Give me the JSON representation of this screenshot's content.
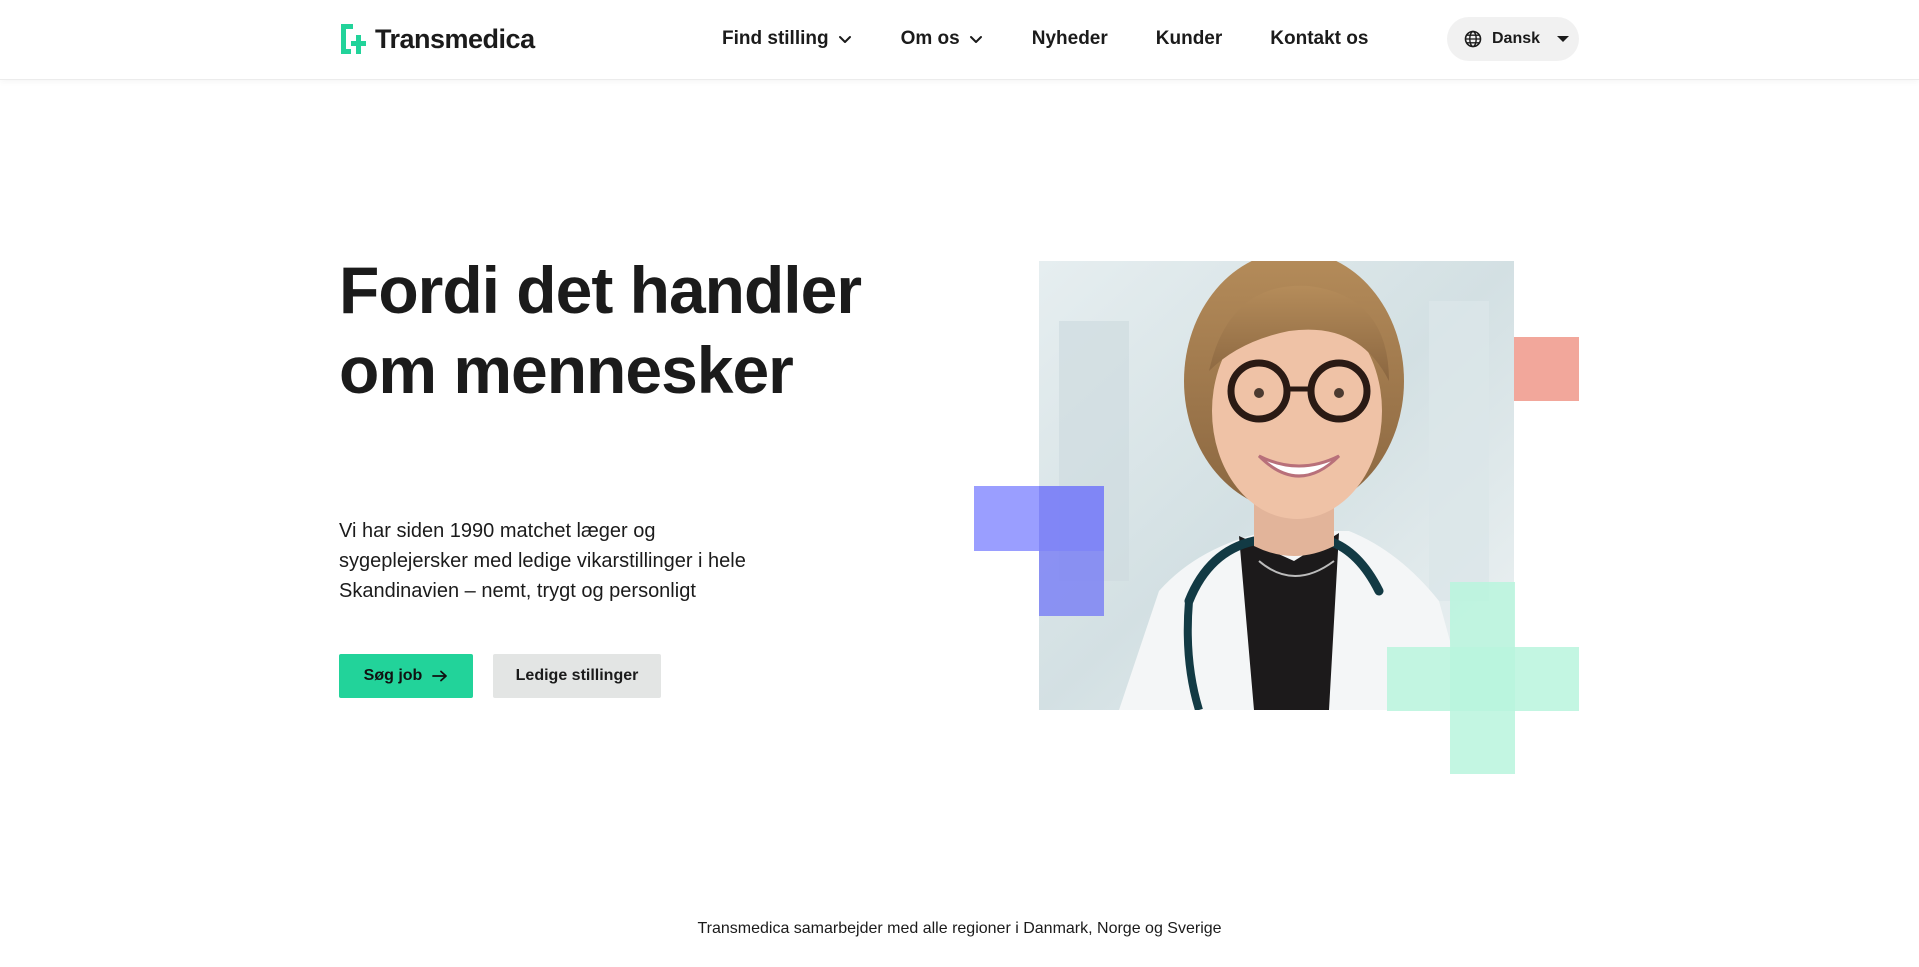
{
  "brand": {
    "name": "Transmedica",
    "accent": "#22d39a"
  },
  "nav": {
    "items": [
      {
        "label": "Find stilling",
        "has_dropdown": true
      },
      {
        "label": "Om os",
        "has_dropdown": true
      },
      {
        "label": "Nyheder",
        "has_dropdown": false
      },
      {
        "label": "Kunder",
        "has_dropdown": false
      },
      {
        "label": "Kontakt os",
        "has_dropdown": false
      }
    ]
  },
  "language": {
    "selected": "Dansk",
    "icon": "globe-icon"
  },
  "hero": {
    "title": "Fordi det handler om mennesker",
    "subtitle": "Vi har siden 1990 matchet læger og sygeplejersker med ledige vikarstillinger i hele Skandinavien – nemt, trygt og personligt",
    "primary_button": "Søg job",
    "secondary_button": "Ledige stillinger"
  },
  "colors": {
    "purple": "#8f94ff",
    "coral": "#f2a79b",
    "mint": "#b9f5dd",
    "button_secondary_bg": "#e3e5e4"
  },
  "footer": {
    "partners_text": "Transmedica samarbejder med alle regioner i Danmark, Norge og Sverige"
  }
}
